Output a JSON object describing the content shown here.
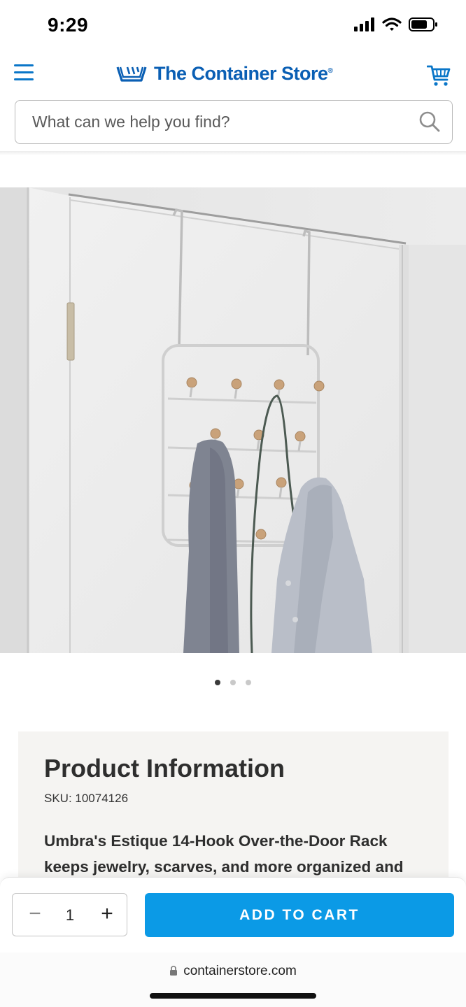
{
  "status_bar": {
    "time": "9:29",
    "icons": [
      "signal-icon",
      "wifi-icon",
      "battery-icon"
    ]
  },
  "header": {
    "brand_name": "The Container Store",
    "brand_mark": "®",
    "menu_icon": "hamburger-menu-icon",
    "cart_icon": "shopping-cart-icon",
    "accent_color": "#0a5fb4"
  },
  "search": {
    "placeholder": "What can we help you find?",
    "value": "",
    "icon": "search-icon"
  },
  "product_image": {
    "carousel_count": 3,
    "active_index": 0
  },
  "product_info": {
    "title": "Product Information",
    "sku": "SKU: 10074126",
    "description": "Umbra's Estique 14-Hook Over-the-Door Rack keeps jewelry, scarves, and more organized and"
  },
  "cart_bar": {
    "qty_minus": "−",
    "quantity": "1",
    "qty_plus": "+",
    "add_label": "ADD TO CART",
    "button_color": "#0b9ae6"
  },
  "browser": {
    "url": "containerstore.com",
    "lock_icon": "lock-icon"
  }
}
